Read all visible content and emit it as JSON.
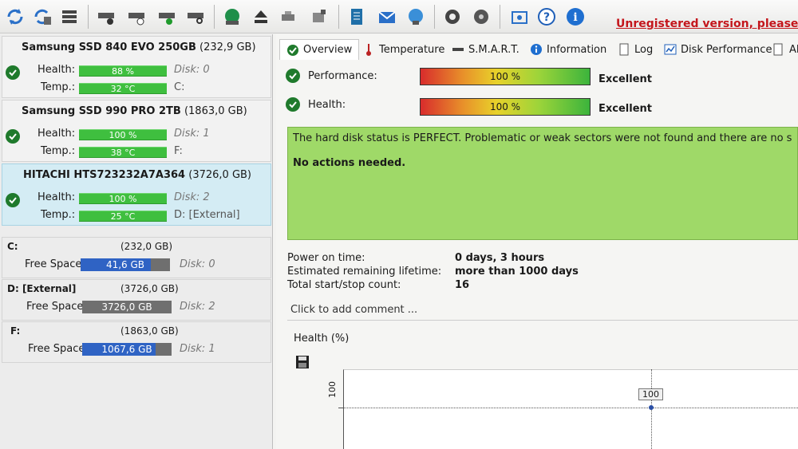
{
  "toolbar": {
    "unregistered": "Unregistered version, please regis"
  },
  "disks": [
    {
      "name": "Samsung SSD 840 EVO 250GB",
      "size": "(232,9 GB)",
      "health_label": "Health:",
      "health": "88 %",
      "health_fraction": 0.88,
      "disk": "Disk: 0",
      "temp_label": "Temp.:",
      "temp": "32 °C",
      "drive": "C:"
    },
    {
      "name": "Samsung SSD 990 PRO 2TB",
      "size": "(1863,0 GB)",
      "health_label": "Health:",
      "health": "100 %",
      "health_fraction": 1.0,
      "disk": "Disk: 1",
      "temp_label": "Temp.:",
      "temp": "38 °C",
      "drive": "F:"
    },
    {
      "name": "HITACHI HTS723232A7A364",
      "size": "(3726,0 GB)",
      "health_label": "Health:",
      "health": "100 %",
      "health_fraction": 1.0,
      "disk": "Disk: 2",
      "temp_label": "Temp.:",
      "temp": "25 °C",
      "drive": "D: [External]"
    }
  ],
  "partitions": [
    {
      "name": "C:",
      "size": "(232,0 GB)",
      "fs_label": "Free Space",
      "free": "41,6 GB",
      "free_fraction": 0.79,
      "disk": "Disk: 0"
    },
    {
      "name": "D: [External]",
      "size": "(3726,0 GB)",
      "fs_label": "Free Space",
      "free": "3726,0 GB",
      "free_fraction": 0.0,
      "disk": "Disk: 2"
    },
    {
      "name": "F:",
      "size": "(1863,0 GB)",
      "fs_label": "Free Space",
      "free": "1067,6 GB",
      "free_fraction": 0.82,
      "disk": "Disk: 1"
    }
  ],
  "tabs": {
    "overview": "Overview",
    "temperature": "Temperature",
    "smart": "S.M.A.R.T.",
    "information": "Information",
    "log": "Log",
    "disk_performance": "Disk Performance",
    "alerts": "Al"
  },
  "overview": {
    "performance_label": "Performance:",
    "performance_value": "100 %",
    "performance_result": "Excellent",
    "health_label": "Health:",
    "health_value": "100 %",
    "health_result": "Excellent",
    "status_line1": "The hard disk status is PERFECT. Problematic or weak sectors were not found and there are no spin up o",
    "status_line2": "No actions needed.",
    "power_on_label": "Power on time:",
    "power_on_value": "0 days, 3 hours",
    "lifetime_label": "Estimated remaining lifetime:",
    "lifetime_value": "more than 1000 days",
    "startstop_label": "Total start/stop count:",
    "startstop_value": "16",
    "comment": "Click to add comment ..."
  },
  "chart_data": {
    "type": "line",
    "title": "Health (%)",
    "y_tick": "100",
    "series": [
      {
        "values": [
          100
        ]
      }
    ],
    "point_label": "100"
  },
  "colors": {
    "status_green": "#9fd968",
    "health_bar": "#3fbf3f",
    "free_space": "#2f63c4",
    "selected_disk": "#d4ecf4",
    "warning_red": "#c4161c"
  }
}
